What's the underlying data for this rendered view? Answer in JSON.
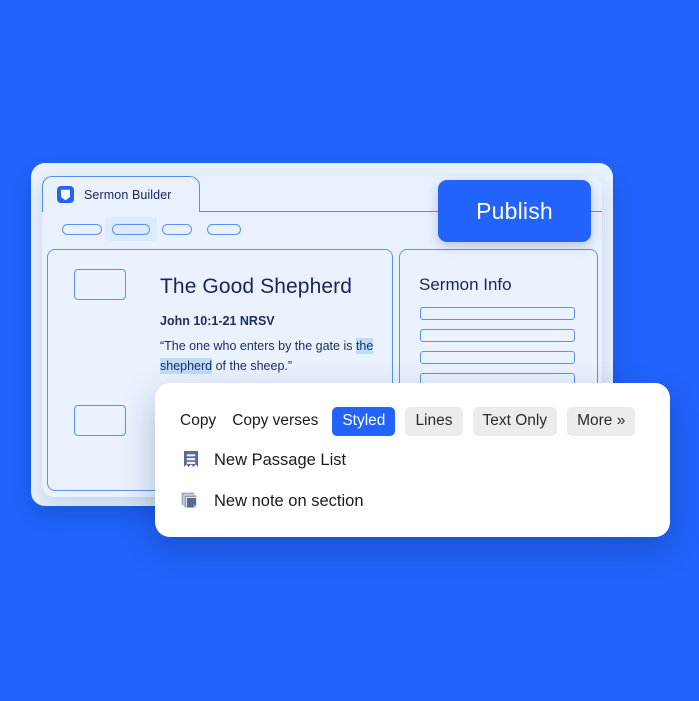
{
  "theme": {
    "background_blue": "#2163fb",
    "accent_blue": "#2163fb",
    "panel_blue_light": "#e8f1fd",
    "outline_blue": "#5b92f2",
    "text_navy": "#17265c",
    "highlight_blue": "#bfdcfb",
    "popup_white": "#ffffff",
    "button_grey": "#ececec"
  },
  "app_window": {
    "tab": {
      "label": "Sermon Builder",
      "icon": "shield-bookmark-icon"
    },
    "toolbar_pills": [
      {
        "name": "pill-1",
        "selected": false
      },
      {
        "name": "pill-2",
        "selected": true
      },
      {
        "name": "pill-3",
        "selected": false
      },
      {
        "name": "pill-4",
        "selected": false
      }
    ],
    "publish_button": {
      "label": "Publish"
    },
    "editor": {
      "title": "The Good Shepherd",
      "reference": "John 10:1-21 NRSV",
      "quote_before": "“The one who enters by the gate is ",
      "quote_highlight": "the shepherd",
      "quote_after": " of the sheep.”",
      "placeholder_boxes": 2
    },
    "info_panel": {
      "title": "Sermon Info",
      "field_bars": 4
    }
  },
  "context_menu": {
    "toolbar": {
      "copy_label": "Copy",
      "copy_verses_label": "Copy verses",
      "options": [
        {
          "label": "Styled",
          "active": true
        },
        {
          "label": "Lines",
          "active": false
        },
        {
          "label": "Text Only",
          "active": false
        },
        {
          "label": "More »",
          "active": false
        }
      ]
    },
    "items": [
      {
        "label": "New Passage List",
        "icon": "passage-list-icon"
      },
      {
        "label": "New note on section",
        "icon": "stacked-notes-icon"
      }
    ]
  }
}
